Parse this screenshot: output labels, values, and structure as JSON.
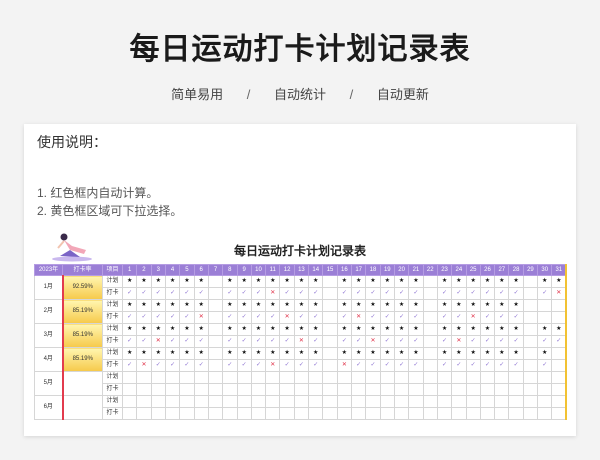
{
  "header": {
    "title": "每日运动打卡计划记录表",
    "subtitles": [
      "简单易用",
      "自动统计",
      "自动更新"
    ],
    "separator": "/"
  },
  "instructions": {
    "title": "使用说明：",
    "lines": [
      "1. 红色框内自动计算。",
      "2. 黄色框区域可下拉选择。"
    ]
  },
  "sheet": {
    "title": "每日运动打卡计划记录表",
    "year_label": "2023年",
    "rate_label": "打卡率",
    "item_label": "项目",
    "days": [
      "1",
      "2",
      "3",
      "4",
      "5",
      "6",
      "7",
      "8",
      "9",
      "10",
      "11",
      "12",
      "13",
      "14",
      "15",
      "16",
      "17",
      "18",
      "19",
      "20",
      "21",
      "22",
      "23",
      "24",
      "25",
      "26",
      "27",
      "28",
      "29",
      "30",
      "31"
    ],
    "plan_label": "计划",
    "checkin_label": "打卡",
    "symbols": {
      "plan": "★",
      "done": "✓",
      "missed": "✕"
    },
    "months": [
      {
        "label": "1月",
        "rate": "92.59%",
        "plan": "SSSSSS.SSSSSSS.SSSSSS.SSSSSS.SS",
        "checkin": "VVVVVV.VVVXVVV.VVVVVV.VVVVVV.VXV"
      },
      {
        "label": "2月",
        "rate": "85.19%",
        "plan": "SSSSSS.SSSSSSS.SSSSSS.SSSSSS...",
        "checkin": "VVVVVX.VVVVXVV.VXVVVV.VVXVVV..."
      },
      {
        "label": "3月",
        "rate": "85.19%",
        "plan": "SSSSSS.SSSSSSS.SSSSSS.SSSSSS.SS",
        "checkin": "VVXVVV.VVVVVXV.VVXVVV.VXVVVV.VV"
      },
      {
        "label": "4月",
        "rate": "85.19%",
        "plan": "SSSSSS.SSSSSSS.SSSSSS.SSSSSS.S.",
        "checkin": "VXVVVV.VVVXVVV.XVVVVV.VVVVVV.V."
      },
      {
        "label": "5月",
        "rate": "",
        "plan": "",
        "checkin": ""
      },
      {
        "label": "6月",
        "rate": "",
        "plan": "",
        "checkin": ""
      }
    ]
  },
  "colors": {
    "header_bg": "#9b7fd6",
    "star": "#111111",
    "check": "#8a6fd0",
    "cross": "#e0334a",
    "rate_fill": "#f6c94a"
  },
  "icons": {
    "figure": "yoga-figure-icon"
  }
}
